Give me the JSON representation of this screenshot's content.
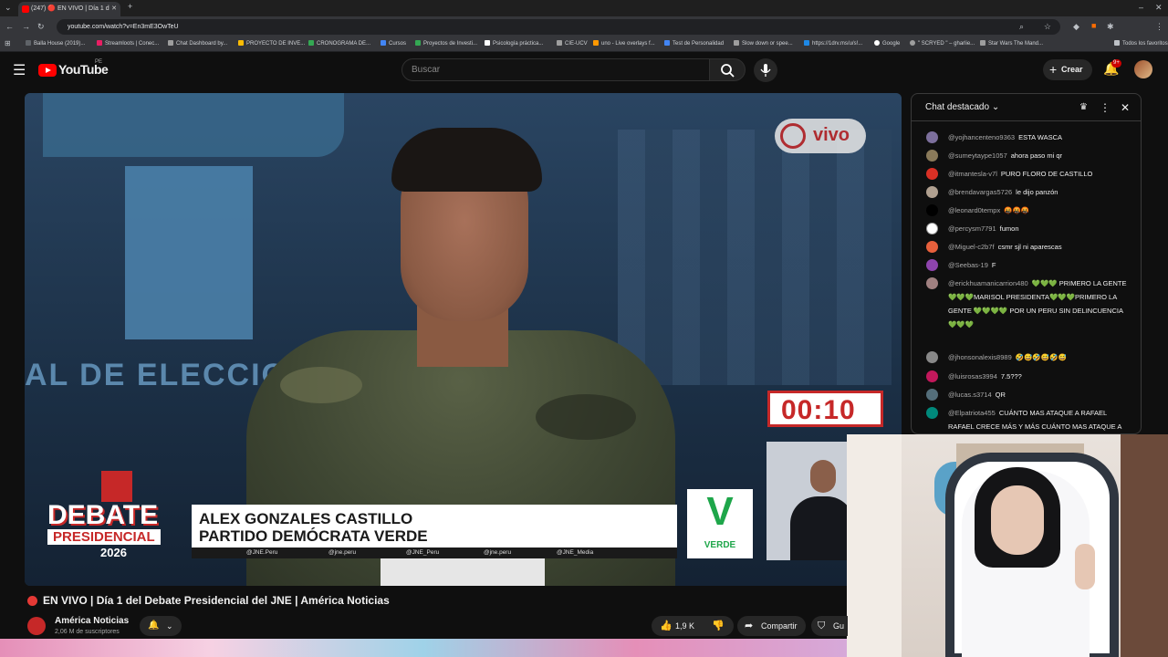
{
  "browser": {
    "tab_title": "(247) 🔴 EN VIVO | Día 1 d",
    "url": "youtube.com/watch?v=En3mE3OwTeU",
    "bookmarks": [
      "Balla House (2019)...",
      "Streamloots | Conec...",
      "Chat Dashboard by...",
      "PROYECTO DE INVE...",
      "CRONOGRAMA DE...",
      "Cursos",
      "Proyectos de Investi...",
      "Psicología práctica...",
      "CIE-UCV",
      "uno - Live overlays f...",
      "Test de Personalidad",
      "Slow down or spee...",
      "https://1drv.ms/u/s!...",
      "Google",
      "\" SCRYED \" – gharlie...",
      "Star Wars The Mand...",
      "Todos los favoritos"
    ]
  },
  "masthead": {
    "logo": "YouTube",
    "region": "PE",
    "search_placeholder": "Buscar",
    "create_label": "Crear",
    "notif_badge": "9+"
  },
  "video": {
    "live_badge": "vivo",
    "timer": "00:10",
    "lower_third_name": "ALEX GONZALES CASTILLO",
    "lower_third_party": "PARTIDO DEMÓCRATA VERDE",
    "debate_line1": "DEBATE",
    "debate_line2": "PRESIDENCIAL",
    "debate_year": "2026",
    "party_letter": "V",
    "party_name": "VERDE",
    "backdrop_text": "AL DE ELECCION",
    "socials": [
      "@JNE.Peru",
      "@jne.peru",
      "@JNE_Peru",
      "@jne.peru",
      "@JNE_Media"
    ]
  },
  "chat": {
    "header": "Chat destacado",
    "messages": [
      {
        "user": "@yojhancenteno9363",
        "text": "ESTA WASCA",
        "color": "#7c6f9c"
      },
      {
        "user": "@sumeytaype1057",
        "text": "ahora paso mi qr",
        "color": "#8a7a5a"
      },
      {
        "user": "@itmantesla-v7l",
        "text": "PURO FLORO DE CASTILLO",
        "color": "#d93025"
      },
      {
        "user": "@brendavargas5726",
        "text": "le dijo panzón",
        "color": "#b0a090"
      },
      {
        "user": "@leonard0tempx",
        "text": "🤬🤬🤬",
        "color": "#000000"
      },
      {
        "user": "@percysm7791",
        "text": "fumon",
        "color": "#ffffff"
      },
      {
        "user": "@Miguel-c2b7f",
        "text": "csmr sjl ni aparescas",
        "color": "#e8603c"
      },
      {
        "user": "@Seebas-19",
        "text": "F",
        "color": "#8e44ad"
      },
      {
        "user": "@erickhuamanicarrion480",
        "text": "💚💚💚 PRIMERO LA GENTE💚💚💚MARISOL PRESIDENTA💚💚💚PRIMERO LA GENTE 💚💚💚💚 POR UN PERU SIN DELINCUENCIA💚💚💚",
        "color": "#a08080"
      },
      {
        "user": "@jhonsonalexis8989",
        "text": "🤣😅🤣😅🤣😅",
        "color": "#888888"
      },
      {
        "user": "@luisrosas3994",
        "text": "7.5???",
        "color": "#c2185b"
      },
      {
        "user": "@lucas.s3714",
        "text": "QR",
        "color": "#546e7a"
      },
      {
        "user": "@Elpatriota455",
        "text": "CUÁNTO MAS ATAQUE A RAFAEL RAFAEL CRECE MÁS Y MÁS CUÁNTO MAS ATAQUE A RAFAEL RAFAEL CRECE MÁS Y MÁS",
        "color": "#00897b"
      }
    ]
  },
  "below": {
    "title": "EN VIVO | Día 1 del Debate Presidencial del JNE | América Noticias",
    "channel": "América Noticias",
    "subs": "2,06 M de suscriptores",
    "likes": "1,9 K",
    "share": "Compartir",
    "save": "Gu"
  }
}
